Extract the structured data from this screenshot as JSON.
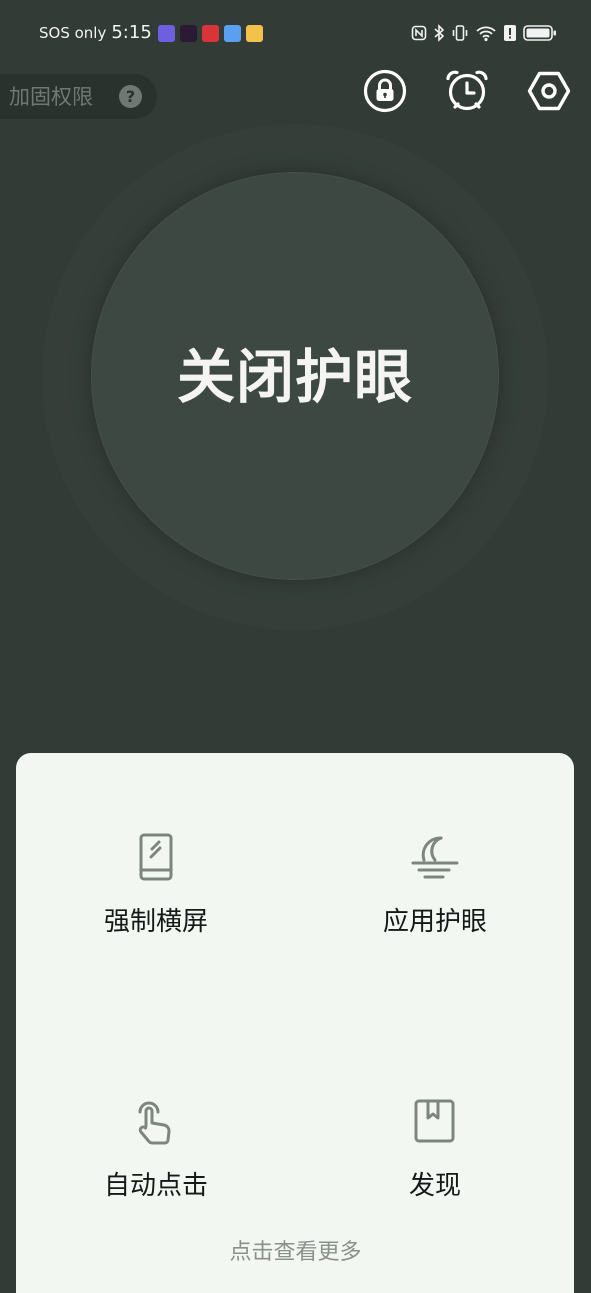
{
  "status_bar": {
    "carrier": "SOS only",
    "time": "5:15",
    "app_icons": [
      {
        "name": "app-notification-icon-1",
        "color": "#6d5fe0"
      },
      {
        "name": "app-notification-icon-2",
        "color": "#2b1a33"
      },
      {
        "name": "app-notification-icon-3",
        "color": "#d8343a"
      },
      {
        "name": "app-notification-icon-4",
        "color": "#5aa0f0"
      },
      {
        "name": "app-notification-icon-5",
        "color": "#f2c24a"
      }
    ],
    "system_icons": [
      "nfc-icon",
      "bluetooth-icon",
      "vibrate-icon",
      "wifi-icon",
      "alert-icon",
      "battery-icon"
    ]
  },
  "header": {
    "permission_label": "加固权限",
    "help_symbol": "?",
    "actions": [
      "lock-button",
      "alarm-button",
      "settings-button"
    ]
  },
  "main": {
    "toggle_label": "关闭护眼"
  },
  "features": [
    {
      "id": "force-landscape",
      "label": "强制横屏",
      "icon": "phone-rotate-icon"
    },
    {
      "id": "app-eye-care",
      "label": "应用护眼",
      "icon": "moon-horizon-icon"
    },
    {
      "id": "auto-click",
      "label": "自动点击",
      "icon": "tap-hand-icon"
    },
    {
      "id": "discover",
      "label": "发现",
      "icon": "bookmark-book-icon"
    }
  ],
  "footer": {
    "more_label": "点击查看更多"
  },
  "colors": {
    "background": "#323b36",
    "circle": "#3e4843",
    "card": "#f2f8f1",
    "icon_gray": "#7d8580"
  }
}
